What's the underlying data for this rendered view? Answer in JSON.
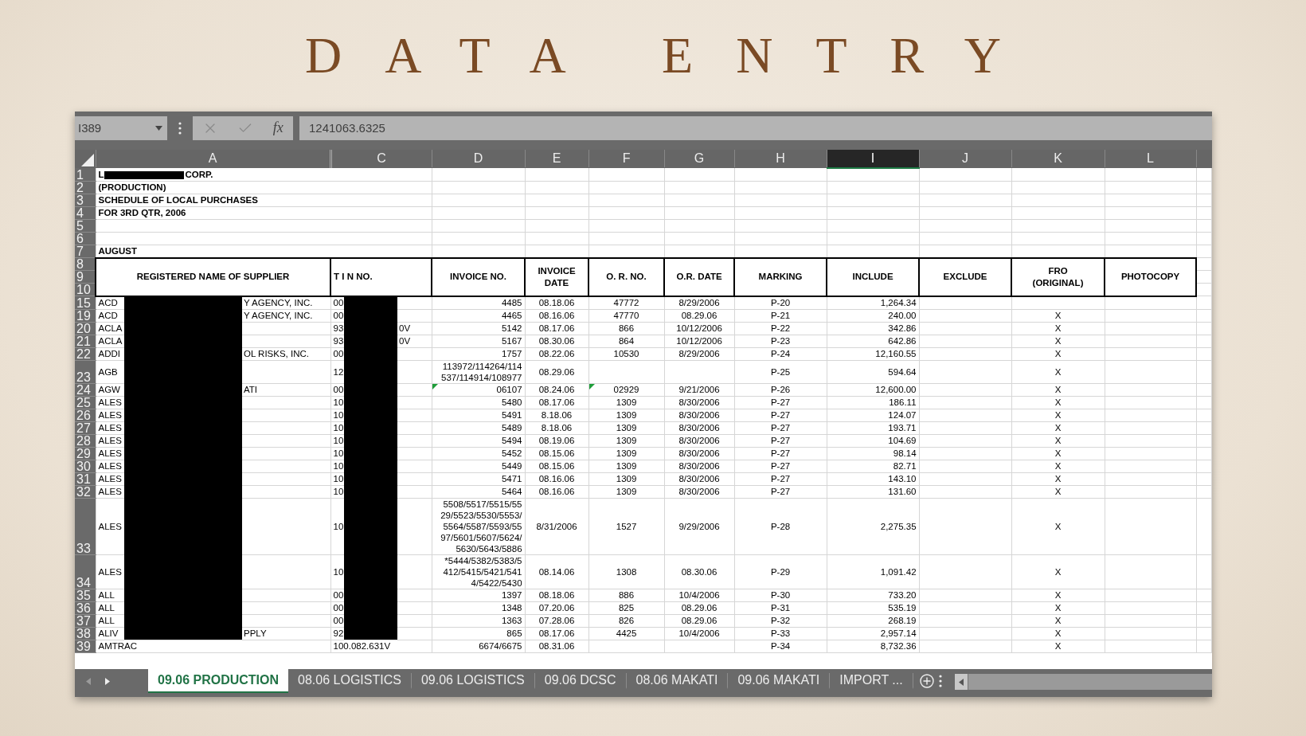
{
  "title": "DATA ENTRY",
  "formula_bar": {
    "name_box": "I389",
    "function_label": "fx",
    "formula": "1241063.6325"
  },
  "column_headers": [
    {
      "label": "A",
      "selected": false
    },
    {
      "label": "C",
      "selected": false
    },
    {
      "label": "D",
      "selected": false
    },
    {
      "label": "E",
      "selected": false
    },
    {
      "label": "F",
      "selected": false
    },
    {
      "label": "G",
      "selected": false
    },
    {
      "label": "H",
      "selected": false
    },
    {
      "label": "I",
      "selected": true
    },
    {
      "label": "J",
      "selected": false
    },
    {
      "label": "K",
      "selected": false
    },
    {
      "label": "L",
      "selected": false
    }
  ],
  "heading_rows": [
    {
      "row": "1",
      "text": "L",
      "text_after": "CORP."
    },
    {
      "row": "2",
      "text": "(PRODUCTION)"
    },
    {
      "row": "3",
      "text": "SCHEDULE OF LOCAL PURCHASES"
    },
    {
      "row": "4",
      "text": "FOR 3RD QTR, 2006"
    },
    {
      "row": "5"
    },
    {
      "row": "6"
    },
    {
      "row": "7",
      "text": "AUGUST"
    }
  ],
  "header_row_numbers": [
    "8",
    "9",
    "10"
  ],
  "table_headers": [
    {
      "label": "REGISTERED NAME OF SUPPLIER"
    },
    {
      "label": "T I N  NO."
    },
    {
      "label": "INVOICE NO."
    },
    {
      "label": "INVOICE\nDATE"
    },
    {
      "label": "O. R.  NO."
    },
    {
      "label": "O.R. DATE"
    },
    {
      "label": "MARKING"
    },
    {
      "label": "INCLUDE"
    },
    {
      "label": "EXCLUDE"
    },
    {
      "label": "FRO\n(ORIGINAL)"
    },
    {
      "label": "PHOTOCOPY"
    }
  ],
  "rows": [
    {
      "row": "15",
      "redacted": true,
      "flagged": false,
      "name": "ACD",
      "name_after": "Y AGENCY, INC.",
      "tin": "00",
      "invoice_no": "4485",
      "invoice_date": "08.18.06",
      "or_no": "47772",
      "or_date": "8/29/2006",
      "marking": "P-20",
      "include": "1,264.34"
    },
    {
      "row": "19",
      "redacted": true,
      "flagged": false,
      "name": "ACD",
      "name_after": "Y AGENCY, INC.",
      "tin": "00",
      "invoice_no": "4465",
      "invoice_date": "08.16.06",
      "or_no": "47770",
      "or_date": "08.29.06",
      "marking": "P-21",
      "include": "240.00",
      "fro": "X"
    },
    {
      "row": "20",
      "redacted": true,
      "flagged": false,
      "name": "ACLA",
      "tin": "93",
      "tin_after": "0V",
      "invoice_no": "5142",
      "invoice_date": "08.17.06",
      "or_no": "866",
      "or_date": "10/12/2006",
      "marking": "P-22",
      "include": "342.86",
      "fro": "X"
    },
    {
      "row": "21",
      "redacted": true,
      "flagged": false,
      "name": "ACLA",
      "tin": "93",
      "tin_after": "0V",
      "invoice_no": "5167",
      "invoice_date": "08.30.06",
      "or_no": "864",
      "or_date": "10/12/2006",
      "marking": "P-23",
      "include": "642.86",
      "fro": "X"
    },
    {
      "row": "22",
      "redacted": true,
      "flagged": false,
      "name": "ADDI",
      "name_after": "OL RISKS, INC.",
      "tin": "00",
      "invoice_no": "1757",
      "invoice_date": "08.22.06",
      "or_no": "10530",
      "or_date": "8/29/2006",
      "marking": "P-24",
      "include": "12,160.55",
      "fro": "X"
    },
    {
      "row": "23",
      "redacted": true,
      "flagged": false,
      "name": "AGB",
      "tin": "12",
      "invoice_no": "113972/114264/114537/114914/108977",
      "invoice_date": "08.29.06",
      "marking": "P-25",
      "include": "594.64",
      "fro": "X"
    },
    {
      "row": "24",
      "redacted": true,
      "flagged": true,
      "name": "AGW",
      "name_after": "ATI",
      "tin": "00",
      "invoice_no": "06107",
      "invoice_date": "08.24.06",
      "or_no": "02929",
      "or_date": "9/21/2006",
      "marking": "P-26",
      "include": "12,600.00",
      "fro": "X"
    },
    {
      "row": "25",
      "redacted": true,
      "flagged": false,
      "name": "ALES",
      "tin": "10",
      "invoice_no": "5480",
      "invoice_date": "08.17.06",
      "or_no": "1309",
      "or_date": "8/30/2006",
      "marking": "P-27",
      "include": "186.11",
      "fro": "X"
    },
    {
      "row": "26",
      "redacted": true,
      "flagged": false,
      "name": "ALES",
      "tin": "10",
      "invoice_no": "5491",
      "invoice_date": "8.18.06",
      "or_no": "1309",
      "or_date": "8/30/2006",
      "marking": "P-27",
      "include": "124.07",
      "fro": "X"
    },
    {
      "row": "27",
      "redacted": true,
      "flagged": false,
      "name": "ALES",
      "tin": "10",
      "invoice_no": "5489",
      "invoice_date": "8.18.06",
      "or_no": "1309",
      "or_date": "8/30/2006",
      "marking": "P-27",
      "include": "193.71",
      "fro": "X"
    },
    {
      "row": "28",
      "redacted": true,
      "flagged": false,
      "name": "ALES",
      "tin": "10",
      "invoice_no": "5494",
      "invoice_date": "08.19.06",
      "or_no": "1309",
      "or_date": "8/30/2006",
      "marking": "P-27",
      "include": "104.69",
      "fro": "X"
    },
    {
      "row": "29",
      "redacted": true,
      "flagged": false,
      "name": "ALES",
      "tin": "10",
      "invoice_no": "5452",
      "invoice_date": "08.15.06",
      "or_no": "1309",
      "or_date": "8/30/2006",
      "marking": "P-27",
      "include": "98.14",
      "fro": "X"
    },
    {
      "row": "30",
      "redacted": true,
      "flagged": false,
      "name": "ALES",
      "tin": "10",
      "invoice_no": "5449",
      "invoice_date": "08.15.06",
      "or_no": "1309",
      "or_date": "8/30/2006",
      "marking": "P-27",
      "include": "82.71",
      "fro": "X"
    },
    {
      "row": "31",
      "redacted": true,
      "flagged": false,
      "name": "ALES",
      "tin": "10",
      "invoice_no": "5471",
      "invoice_date": "08.16.06",
      "or_no": "1309",
      "or_date": "8/30/2006",
      "marking": "P-27",
      "include": "143.10",
      "fro": "X"
    },
    {
      "row": "32",
      "redacted": true,
      "flagged": false,
      "name": "ALES",
      "tin": "10",
      "invoice_no": "5464",
      "invoice_date": "08.16.06",
      "or_no": "1309",
      "or_date": "8/30/2006",
      "marking": "P-27",
      "include": "131.60",
      "fro": "X"
    },
    {
      "row": "33",
      "redacted": true,
      "flagged": false,
      "name": "ALES",
      "tin": "10",
      "invoice_no": "5508/5517/5515/5529/5523/5530/5553/5564/5587/5593/5597/5601/5607/5624/5630/5643/5886",
      "invoice_date": "8/31/2006",
      "or_no": "1527",
      "or_date": "9/29/2006",
      "marking": "P-28",
      "include": "2,275.35",
      "fro": "X"
    },
    {
      "row": "34",
      "redacted": true,
      "flagged": false,
      "name": "ALES",
      "tin": "10",
      "invoice_no": "*5444/5382/5383/5412/5415/5421/5414/5422/5430",
      "invoice_date": "08.14.06",
      "or_no": "1308",
      "or_date": "08.30.06",
      "marking": "P-29",
      "include": "1,091.42",
      "fro": "X"
    },
    {
      "row": "35",
      "redacted": true,
      "flagged": false,
      "name": "ALL",
      "tin": "00",
      "invoice_no": "1397",
      "invoice_date": "08.18.06",
      "or_no": "886",
      "or_date": "10/4/2006",
      "marking": "P-30",
      "include": "733.20",
      "fro": "X"
    },
    {
      "row": "36",
      "redacted": true,
      "flagged": false,
      "name": "ALL",
      "tin": "00",
      "invoice_no": "1348",
      "invoice_date": "07.20.06",
      "or_no": "825",
      "or_date": "08.29.06",
      "marking": "P-31",
      "include": "535.19",
      "fro": "X"
    },
    {
      "row": "37",
      "redacted": true,
      "flagged": false,
      "name": "ALL",
      "tin": "00",
      "invoice_no": "1363",
      "invoice_date": "07.28.06",
      "or_no": "826",
      "or_date": "08.29.06",
      "marking": "P-32",
      "include": "268.19",
      "fro": "X"
    },
    {
      "row": "38",
      "redacted": true,
      "flagged": false,
      "name": "ALIV",
      "name_after": "PPLY",
      "tin": "92",
      "invoice_no": "865",
      "invoice_date": "08.17.06",
      "or_no": "4425",
      "or_date": "10/4/2006",
      "marking": "P-33",
      "include": "2,957.14",
      "fro": "X"
    },
    {
      "row": "39",
      "redacted": false,
      "flagged": false,
      "name": "AMTRAC",
      "tin": "100.082.631V",
      "invoice_no": "6674/6675",
      "invoice_date": "08.31.06",
      "marking": "P-34",
      "include": "8,732.36",
      "fro": "X"
    }
  ],
  "sheet_tabs": [
    {
      "label": "09.06 PRODUCTION",
      "selected": true
    },
    {
      "label": "08.06 LOGISTICS",
      "selected": false
    },
    {
      "label": "09.06 LOGISTICS",
      "selected": false
    },
    {
      "label": "09.06 DCSC",
      "selected": false
    },
    {
      "label": "08.06 MAKATI",
      "selected": false
    },
    {
      "label": "09.06 MAKATI",
      "selected": false
    },
    {
      "label": "IMPORT ...",
      "selected": false
    }
  ]
}
